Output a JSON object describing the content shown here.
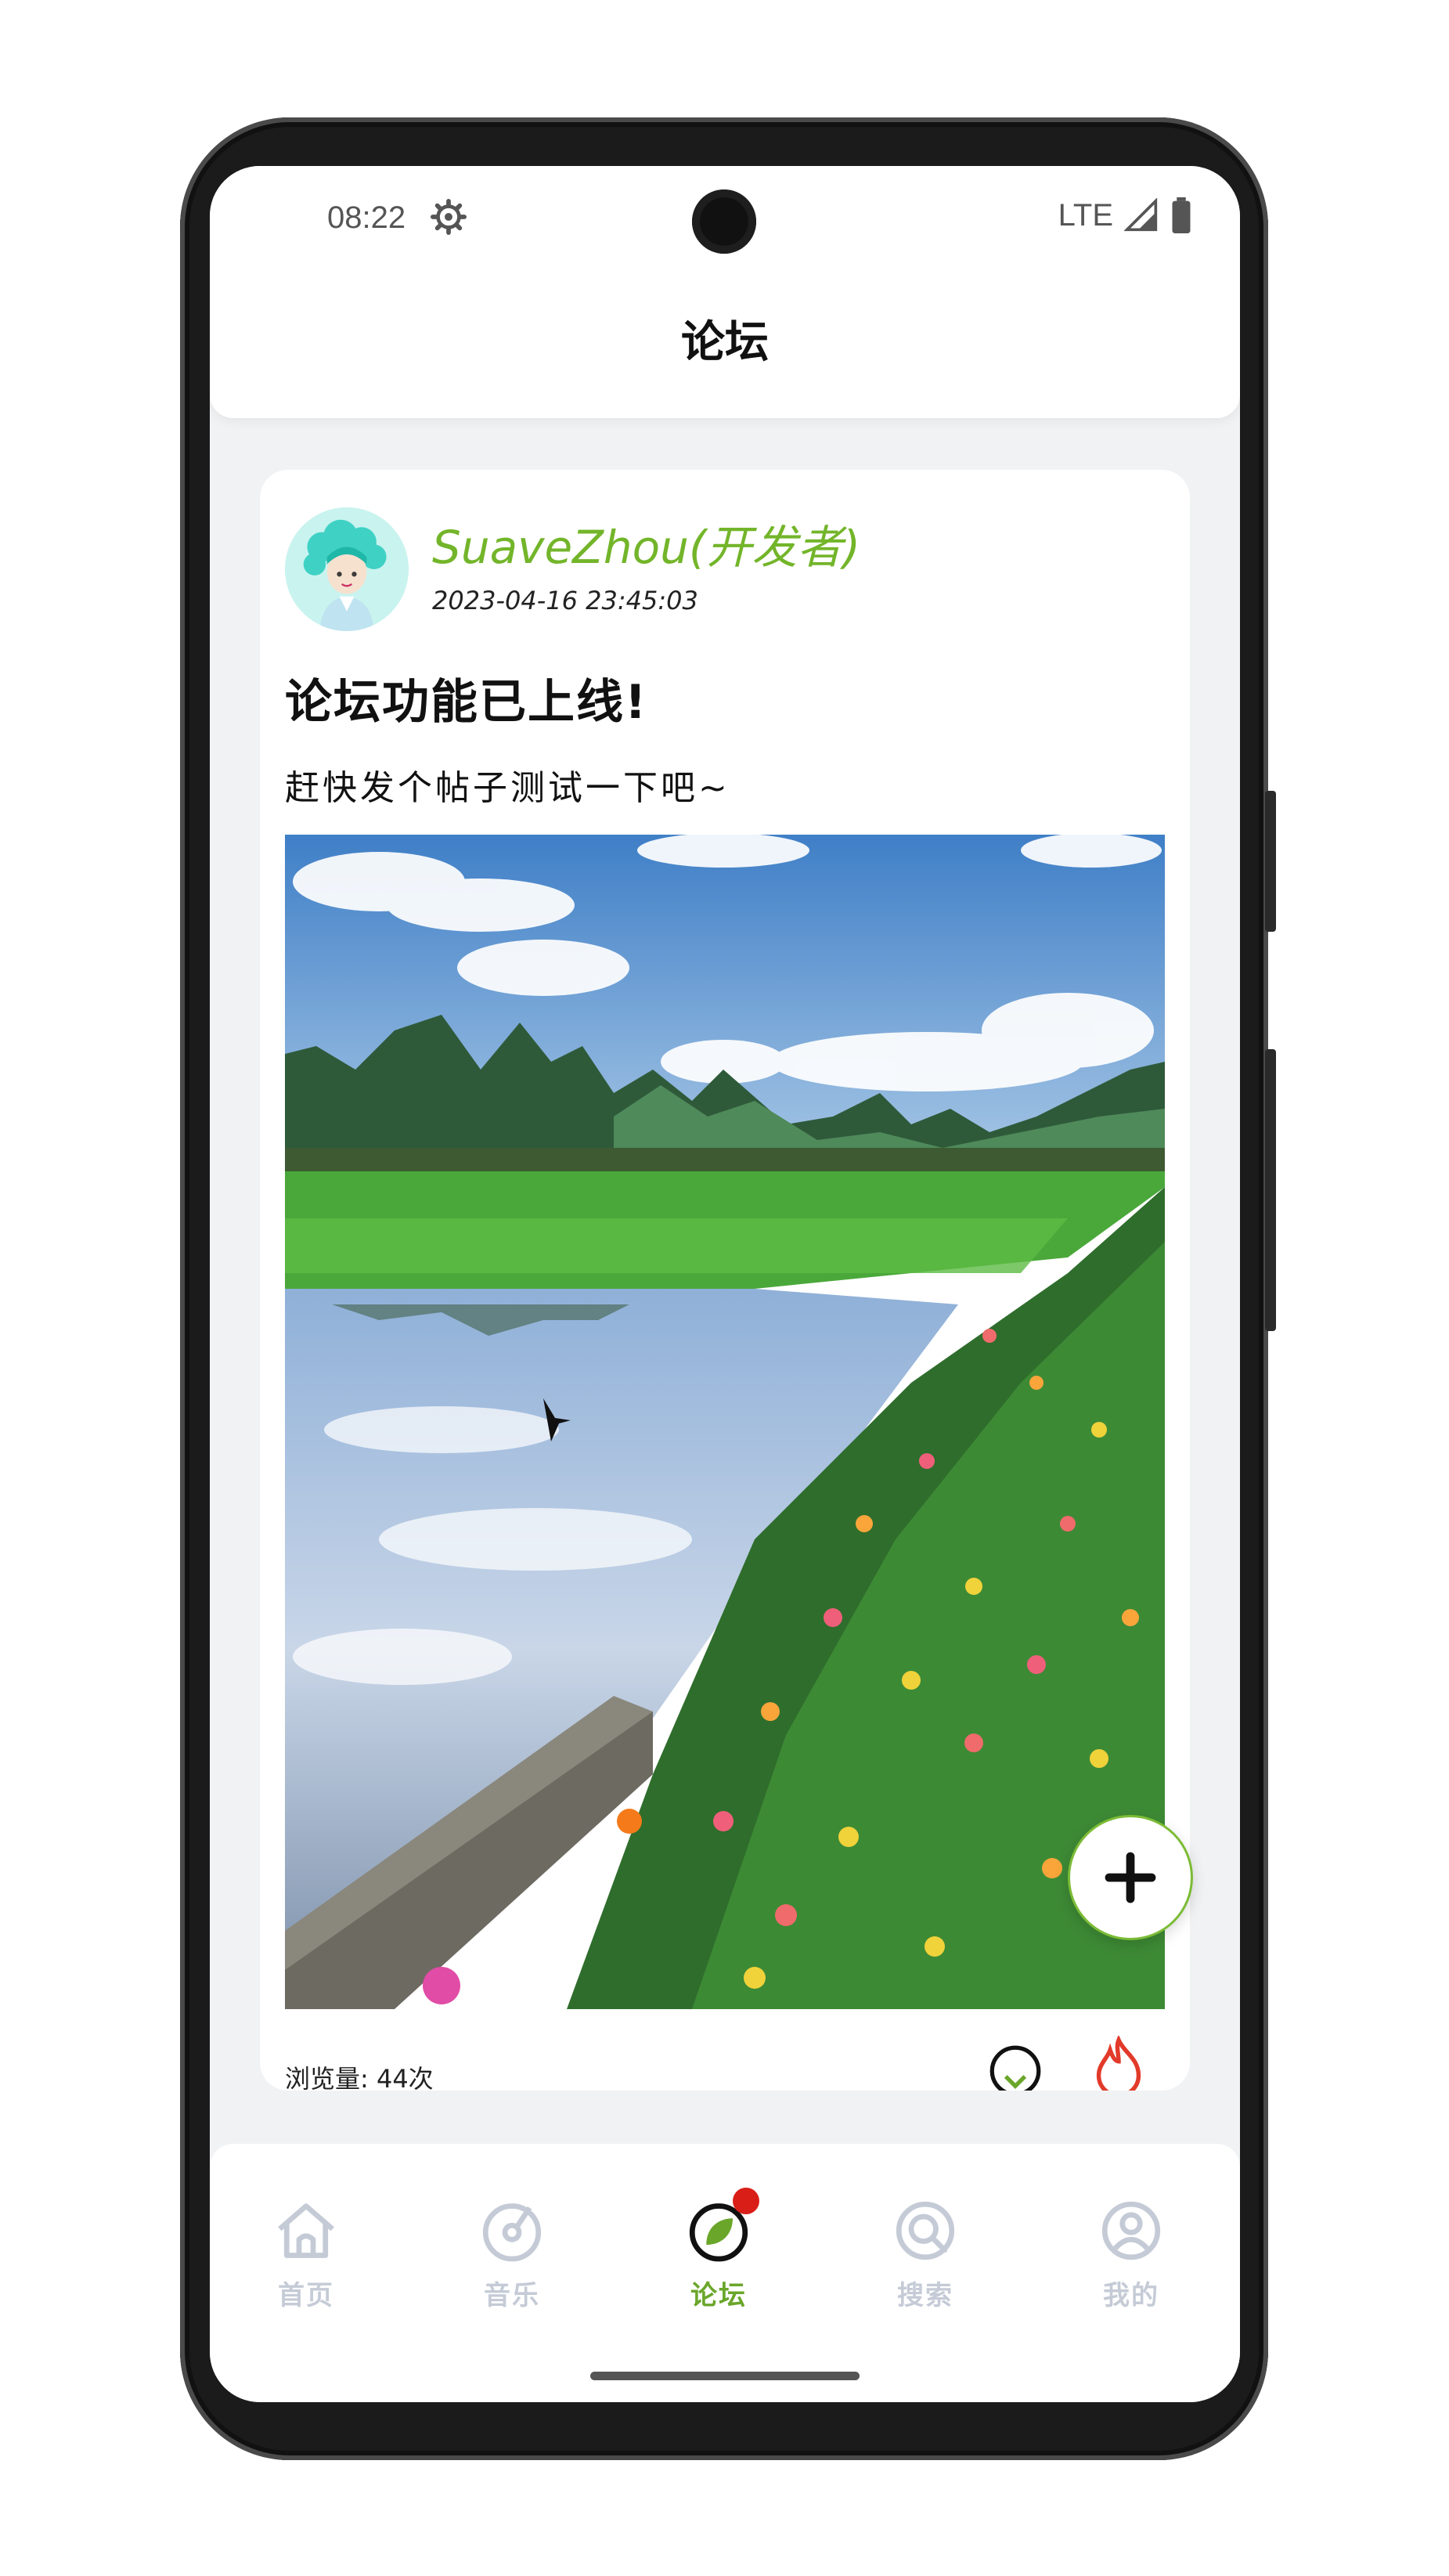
{
  "status_bar": {
    "time": "08:22",
    "network": "LTE"
  },
  "header": {
    "title": "论坛"
  },
  "post": {
    "username": "SuaveZhou(开发者)",
    "timestamp": "2023-04-16 23:45:03",
    "title": "论坛功能已上线!",
    "body": "赶快发个帖子测试一下吧~",
    "views": "浏览量: 44次"
  },
  "bottom_nav": {
    "items": [
      {
        "label": "首页"
      },
      {
        "label": "音乐"
      },
      {
        "label": "论坛"
      },
      {
        "label": "搜索"
      },
      {
        "label": "我的"
      }
    ],
    "active": "论坛"
  },
  "colors": {
    "accent": "#73b52a",
    "badge": "#d91e18",
    "inactive": "#c5cbd6"
  },
  "icons": [
    "settings-gear-icon",
    "signal-icon",
    "battery-icon",
    "like-icon",
    "fire-icon",
    "plus-icon",
    "home-icon",
    "music-icon",
    "forum-leaf-icon",
    "search-icon",
    "profile-icon"
  ]
}
